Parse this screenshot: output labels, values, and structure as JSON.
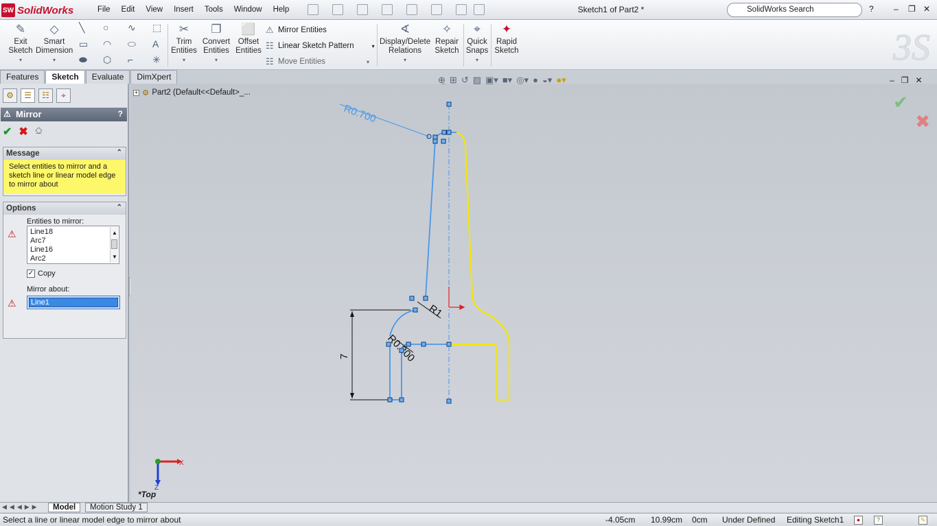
{
  "app": {
    "logo_text": "SolidWorks",
    "logo_badge": "SW",
    "document_title": "Sketch1 of Part2 *"
  },
  "menu": [
    "File",
    "Edit",
    "View",
    "Insert",
    "Tools",
    "Window",
    "Help"
  ],
  "search": {
    "value": "SolidWorks Search",
    "help": "?"
  },
  "command_manager": {
    "exit_sketch": "Exit Sketch",
    "smart_dimension": "Smart Dimension",
    "trim_entities": "Trim Entities",
    "convert_entities": "Convert Entities",
    "offset_entities": "Offset Entities",
    "mirror_entities": "Mirror Entities",
    "linear_sketch_pattern": "Linear Sketch Pattern",
    "move_entities": "Move Entities",
    "display_delete_relations": "Display/Delete Relations",
    "repair_sketch": "Repair Sketch",
    "quick_snaps": "Quick Snaps",
    "rapid_sketch": "Rapid Sketch"
  },
  "tabs": [
    "Features",
    "Sketch",
    "Evaluate",
    "DimXpert"
  ],
  "active_tab": "Sketch",
  "property_manager": {
    "title": "Mirror",
    "help": "?",
    "message_header": "Message",
    "message": "Select entities to mirror and a sketch line or linear model edge to mirror about",
    "options_header": "Options",
    "entities_label": "Entities to mirror:",
    "entities": [
      "Line18",
      "Arc7",
      "Line16",
      "Arc2"
    ],
    "copy_label": "Copy",
    "copy_checked": true,
    "mirror_about_label": "Mirror about:",
    "mirror_about_value": "Line1"
  },
  "tree": {
    "part": "Part2  (Default<<Default>_..."
  },
  "sketch": {
    "dim_r1": "R0.700",
    "dim_r2": "R1",
    "dim_r3": "R0.300",
    "dim_height": "7",
    "axis_x": "X",
    "axis_z": "Z",
    "view_label": "*Top"
  },
  "bottom_tabs": [
    "Model",
    "Motion Study 1"
  ],
  "status": {
    "message": "Select a line or linear model edge to mirror about",
    "x": "-4.05cm",
    "y": "10.99cm",
    "z": "0cm",
    "state": "Under Defined",
    "editing": "Editing Sketch1"
  },
  "colors": {
    "sketch_blue": "#4a97e8",
    "mirror_yellow": "#f5e600",
    "accent_red": "#c8102e"
  }
}
